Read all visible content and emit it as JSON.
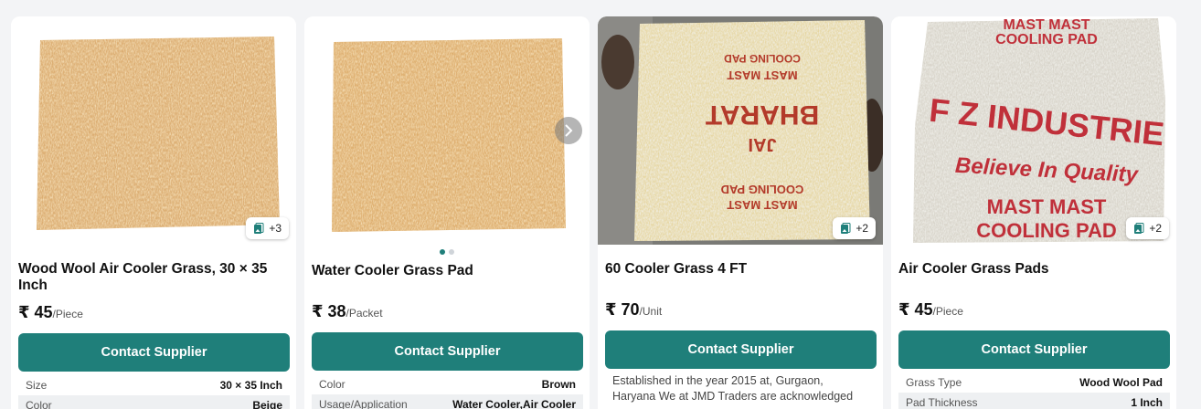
{
  "products": [
    {
      "title": "Wood Wool Air Cooler Grass, 30 × 35 Inch",
      "price": "₹ 45",
      "unit": "/Piece",
      "more_images": "+3",
      "cta": "Contact Supplier",
      "specs": [
        {
          "label": "Size",
          "value": "30 × 35 Inch"
        },
        {
          "label": "Color",
          "value": "Beige"
        }
      ]
    },
    {
      "title": "Water Cooler Grass Pad",
      "price": "₹ 38",
      "unit": "/Packet",
      "carousel_dots": 2,
      "active_dot": 1,
      "cta": "Contact Supplier",
      "specs": [
        {
          "label": "Color",
          "value": "Brown"
        },
        {
          "label": "Usage/Application",
          "value": "Water Cooler,Air Cooler"
        }
      ]
    },
    {
      "title": "60 Cooler Grass 4 FT",
      "price": "₹ 70",
      "unit": "/Unit",
      "more_images": "+2",
      "cta": "Contact Supplier",
      "description": "Established in the year 2015 at, Gurgaon, Haryana We at JMD Traders are acknowledged",
      "bag_text": [
        "MAST MAST",
        "COOLING PAD",
        "JAI",
        "BHARAT"
      ]
    },
    {
      "title": "Air Cooler Grass Pads",
      "price": "₹ 45",
      "unit": "/Piece",
      "more_images": "+2",
      "cta": "Contact Supplier",
      "specs": [
        {
          "label": "Grass Type",
          "value": "Wood Wool Pad"
        },
        {
          "label": "Pad Thickness",
          "value": "1 Inch"
        }
      ],
      "bag_text": [
        "MAST MAST",
        "COOLING PAD",
        "F Z INDUSTRIE",
        "Believe In Quality"
      ]
    }
  ],
  "colors": {
    "accent": "#1f7f7a",
    "page_bg": "#f3f4f6"
  }
}
